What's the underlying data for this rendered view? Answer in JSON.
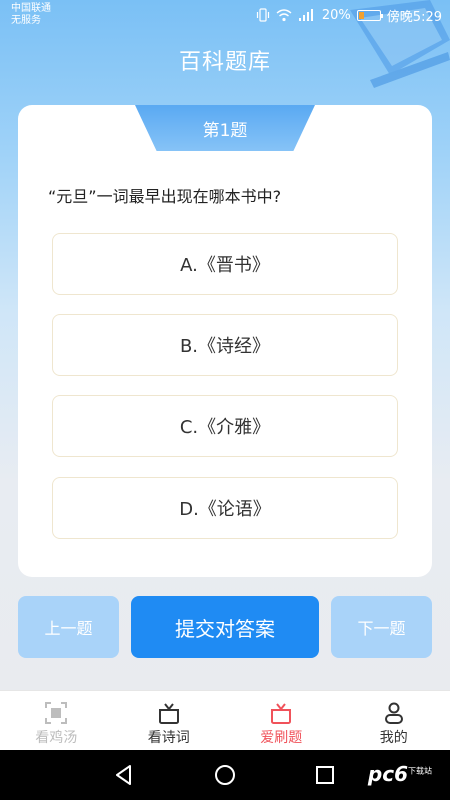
{
  "status_bar": {
    "carrier_line1": "中国联通",
    "carrier_line2": "无服务",
    "battery": "20%",
    "time": "傍晚5:29"
  },
  "header": {
    "title": "百科题库"
  },
  "quiz": {
    "number_label": "第1题",
    "question": "“元旦”一词最早出现在哪本书中?",
    "options": [
      {
        "label": "A.《晋书》"
      },
      {
        "label": "B.《诗经》"
      },
      {
        "label": "C.《介雅》"
      },
      {
        "label": "D.《论语》"
      }
    ]
  },
  "actions": {
    "prev_label": "上一题",
    "submit_label": "提交对答案",
    "next_label": "下一题"
  },
  "tabs": [
    {
      "label": "看鸡汤",
      "icon": "scan-icon",
      "color": "#bdbdbd",
      "active": false
    },
    {
      "label": "看诗词",
      "icon": "gift-icon",
      "color": "#333333",
      "active": false
    },
    {
      "label": "爱刷题",
      "icon": "gift-icon",
      "color": "#f0525a",
      "active": true
    },
    {
      "label": "我的",
      "icon": "person-icon",
      "color": "#333333",
      "active": false
    }
  ],
  "watermark": {
    "text": "pc6",
    "sub": "下载站"
  },
  "colors": {
    "accent": "#1f8bf3",
    "accent_light": "#a9d3f9",
    "active_tab": "#f0525a"
  }
}
